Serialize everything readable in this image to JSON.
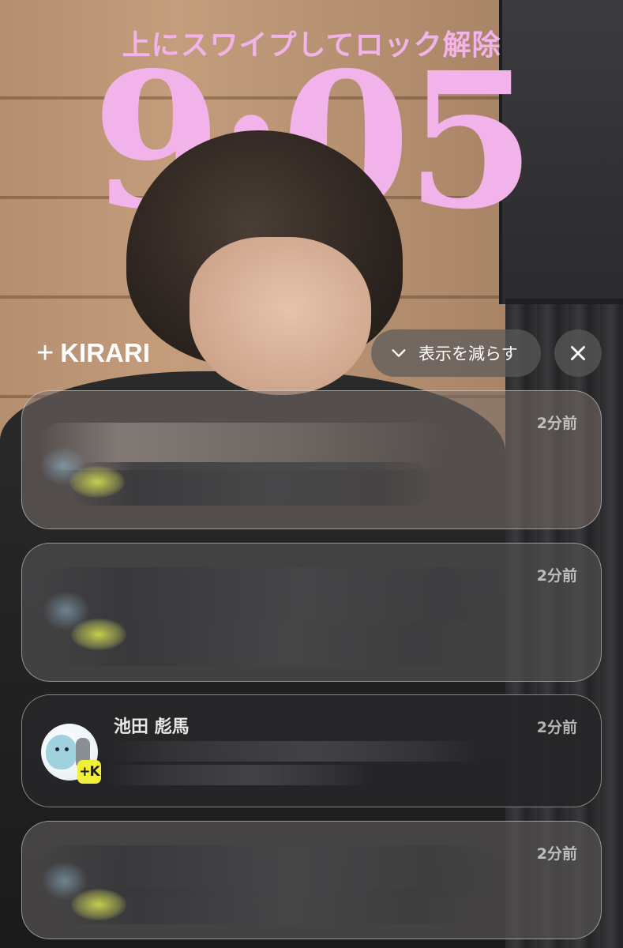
{
  "lockscreen": {
    "unlock_hint": "上にスワイプしてロック解除",
    "time": "9:05",
    "accent_color": "#f2b3ea"
  },
  "notification_group": {
    "app_name": "KIRARI",
    "plus_icon": "plus-icon",
    "show_less_label": "表示を減らす",
    "show_less_icon": "chevron-down-icon",
    "close_icon": "close-icon"
  },
  "notifications": [
    {
      "time": "2分前",
      "blurred": true
    },
    {
      "time": "2分前",
      "blurred": true
    },
    {
      "time": "2分前",
      "blurred": false,
      "sender": "池田 彪馬",
      "app_badge": "+K",
      "badge_color": "#f0ef3c"
    },
    {
      "time": "2分前",
      "blurred": true
    }
  ]
}
